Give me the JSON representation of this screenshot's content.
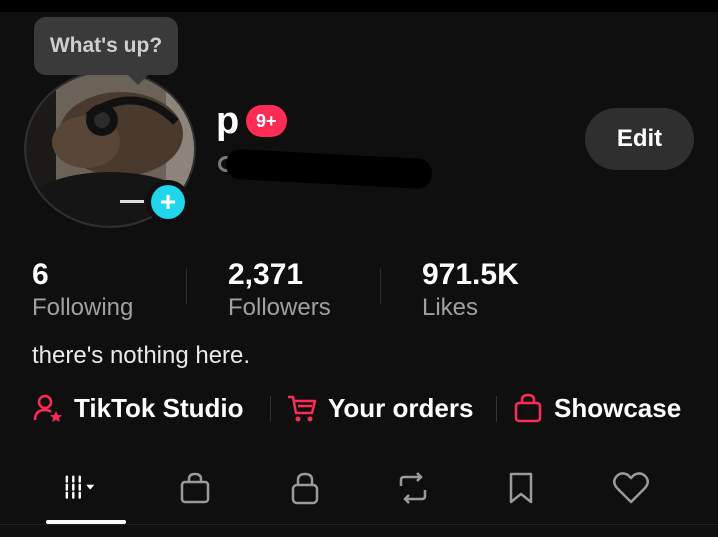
{
  "bubble": {
    "text": "What's up?"
  },
  "profile": {
    "name": "p",
    "notification_badge": "9+",
    "edit_label": "Edit",
    "bio": "there's nothing here."
  },
  "stats": [
    {
      "value": "6",
      "label": "Following"
    },
    {
      "value": "2,371",
      "label": "Followers"
    },
    {
      "value": "971.5K",
      "label": "Likes"
    }
  ],
  "quick_links": [
    {
      "label": "TikTok Studio",
      "icon": "creator-star-icon"
    },
    {
      "label": "Your orders",
      "icon": "cart-icon"
    },
    {
      "label": "Showcase",
      "icon": "shopping-bag-icon"
    }
  ],
  "tabs": [
    {
      "icon": "grid-icon",
      "active": true
    },
    {
      "icon": "shopping-bag-icon"
    },
    {
      "icon": "lock-icon"
    },
    {
      "icon": "repost-icon"
    },
    {
      "icon": "bookmark-icon"
    },
    {
      "icon": "heart-icon"
    }
  ],
  "colors": {
    "accent": "#fe2c55",
    "add": "#20d5ec",
    "background": "#0f0f0f"
  }
}
